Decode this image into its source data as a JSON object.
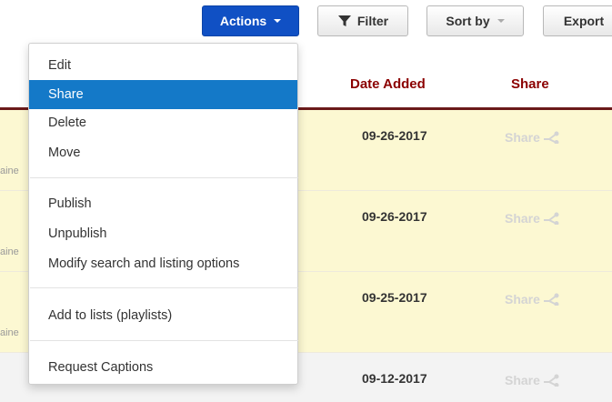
{
  "toolbar": {
    "actions_label": "Actions",
    "filter_label": "Filter",
    "sort_label": "Sort by",
    "export_label": "Export"
  },
  "table": {
    "columns": {
      "date_added": "Date Added",
      "share": "Share"
    },
    "rows": [
      {
        "date": "09-26-2017",
        "share_label": "Share",
        "owner_fragment": "aine"
      },
      {
        "date": "09-26-2017",
        "share_label": "Share",
        "owner_fragment": "aine"
      },
      {
        "date": "09-25-2017",
        "share_label": "Share",
        "owner_fragment": "aine"
      },
      {
        "date": "09-12-2017",
        "share_label": "Share",
        "owner_fragment": ""
      }
    ]
  },
  "actions_menu": {
    "items": [
      {
        "label": "Edit"
      },
      {
        "label": "Share",
        "active": true
      },
      {
        "label": "Delete"
      },
      {
        "label": "Move"
      },
      {
        "label": "Publish"
      },
      {
        "label": "Unpublish"
      },
      {
        "label": "Modify search and listing options"
      },
      {
        "label": "Add to lists (playlists)"
      },
      {
        "label": "Request Captions"
      }
    ]
  },
  "colors": {
    "primary_button": "#1050c4",
    "menu_active": "#1479c8",
    "header_text": "#8b0000",
    "header_rule": "#6b1a1a",
    "row_highlight": "#fcf8d2",
    "share_disabled": "#d4d4d4"
  },
  "icons": {
    "filter": "funnel-icon",
    "caret": "chevron-down-icon",
    "share": "share-icon"
  }
}
